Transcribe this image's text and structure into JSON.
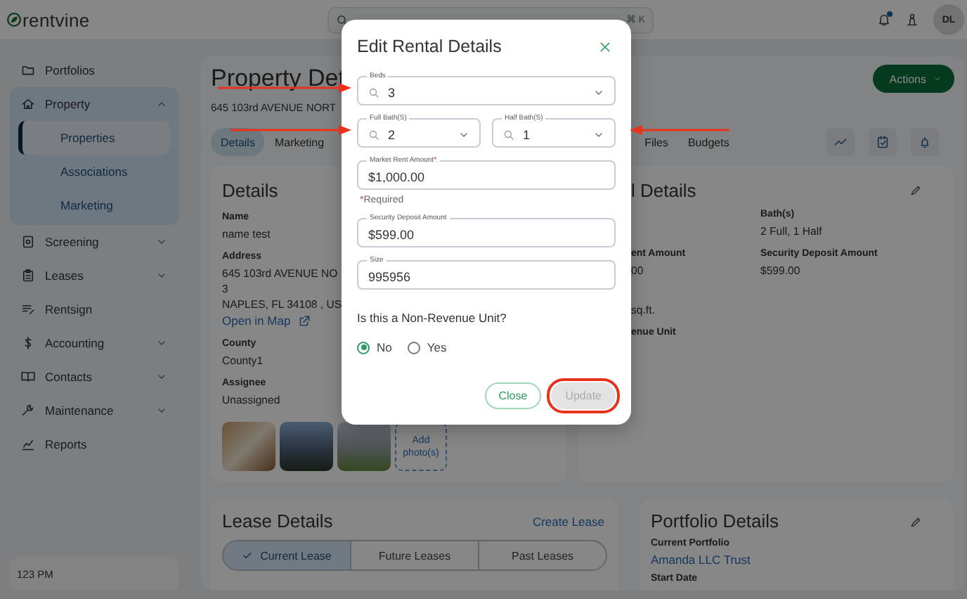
{
  "topbar": {
    "logo": "rentvine",
    "search_shortcut": "⌘ K",
    "notification_dot": true,
    "avatar": "DL"
  },
  "sidebar": {
    "items": [
      {
        "label": "Portfolios",
        "kind": "link"
      },
      {
        "label": "Property",
        "kind": "group",
        "expanded": true,
        "children": [
          {
            "label": "Properties",
            "selected": true
          },
          {
            "label": "Associations",
            "selected": false
          },
          {
            "label": "Marketing",
            "selected": false
          }
        ]
      },
      {
        "label": "Screening",
        "kind": "group",
        "expanded": false
      },
      {
        "label": "Leases",
        "kind": "group",
        "expanded": false
      },
      {
        "label": "Rentsign",
        "kind": "link"
      },
      {
        "label": "Accounting",
        "kind": "group",
        "expanded": false
      },
      {
        "label": "Contacts",
        "kind": "group",
        "expanded": false
      },
      {
        "label": "Maintenance",
        "kind": "group",
        "expanded": false
      },
      {
        "label": "Reports",
        "kind": "link"
      }
    ],
    "footer": "123 PM"
  },
  "page": {
    "title": "Property Det",
    "address": "645 103rd AVENUE NORT",
    "actions_button": "Actions",
    "tabs": [
      {
        "label": "Details",
        "selected": true
      },
      {
        "label": "Marketing",
        "selected": false
      },
      {
        "label": "Files",
        "selected": false
      },
      {
        "label": "Budgets",
        "selected": false
      }
    ],
    "details": {
      "title": "Details",
      "fields": [
        {
          "label": "Name",
          "lines": [
            "name test"
          ]
        },
        {
          "label": "Address",
          "lines": [
            "645 103rd AVENUE NO",
            "3",
            "NAPLES, FL 34108 , US"
          ],
          "link": "Open in Map"
        },
        {
          "label": "County",
          "lines": [
            "County1"
          ]
        },
        {
          "label": "Assignee",
          "lines": [
            "Unassigned"
          ]
        }
      ],
      "photos": [
        {
          "kind": "interior"
        },
        {
          "kind": "house-dusk"
        },
        {
          "kind": "house-lawn"
        }
      ],
      "add_photos": "Add photo(s)"
    },
    "rental_details": {
      "title": "l Details",
      "rows": [
        [
          null,
          {
            "label": "Bath(s)",
            "value": "2 Full, 1 Half"
          }
        ],
        [
          {
            "label": "ent Amount",
            "value": "00"
          },
          {
            "label": "Security Deposit Amount",
            "value": "$599.00"
          }
        ],
        [
          {
            "value": "sq.ft."
          }
        ],
        [
          {
            "label": "enue Unit"
          }
        ]
      ]
    },
    "lease_details": {
      "title": "Lease Details",
      "create_link": "Create Lease",
      "tabs": [
        {
          "label": "Current Lease",
          "selected": true
        },
        {
          "label": "Future Leases",
          "selected": false
        },
        {
          "label": "Past Leases",
          "selected": false
        }
      ]
    },
    "portfolio_details": {
      "title": "Portfolio Details",
      "fields": [
        {
          "label": "Current Portfolio",
          "link": "Amanda LLC Trust"
        },
        {
          "label": "Start Date"
        }
      ]
    }
  },
  "modal": {
    "title": "Edit Rental Details",
    "rows": [
      [
        {
          "kind": "select",
          "label": "Beds",
          "value": "3",
          "annotation": {
            "kind": "arrow-from-left"
          }
        }
      ],
      [
        {
          "kind": "select",
          "label": "Full Bath(S)",
          "value": "2",
          "annotation": {
            "kind": "arrow-from-left"
          }
        },
        {
          "kind": "select",
          "label": "Half Bath(S)",
          "value": "1",
          "annotation": {
            "kind": "arrow-from-right"
          }
        }
      ],
      [
        {
          "kind": "text",
          "label": "Market Rent Amount",
          "required_mark": "*",
          "value": "$1,000.00",
          "helper_mark": "*",
          "helper": "Required"
        }
      ],
      [
        {
          "kind": "text",
          "label": "Security Deposit Amount",
          "value": "$599.00"
        }
      ],
      [
        {
          "kind": "text",
          "label": "Size",
          "value": "995956"
        }
      ]
    ],
    "question": {
      "text": "Is this a Non-Revenue Unit?",
      "options": [
        {
          "label": "No",
          "selected": true
        },
        {
          "label": "Yes",
          "selected": false
        }
      ]
    },
    "buttons": [
      {
        "label": "Close",
        "kind": "outline",
        "disabled": false
      },
      {
        "label": "Update",
        "kind": "primary",
        "disabled": true,
        "annotation": {
          "kind": "circle"
        }
      }
    ]
  }
}
